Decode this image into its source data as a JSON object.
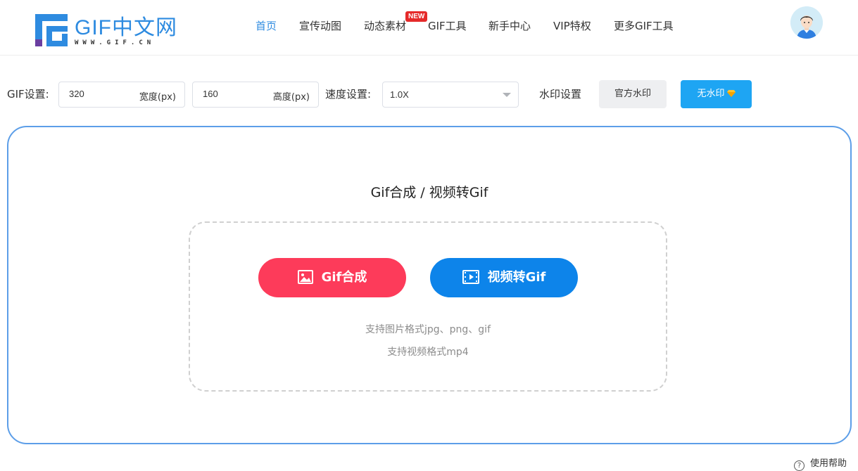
{
  "header": {
    "logo_text": "GIF中文网",
    "logo_sub": "WWW.GIF.CN",
    "nav": [
      {
        "label": "首页"
      },
      {
        "label": "宣传动图"
      },
      {
        "label": "动态素材"
      },
      {
        "label": "GIF工具"
      },
      {
        "label": "新手中心"
      },
      {
        "label": "VIP特权"
      },
      {
        "label": "更多GIF工具"
      }
    ],
    "new_badge": "NEW",
    "active_color": "#2e8be0"
  },
  "settings": {
    "gif_label": "GIF设置:",
    "width_value": "320",
    "width_unit": "宽度(px)",
    "height_value": "160",
    "height_unit": "高度(px)",
    "speed_label": "速度设置:",
    "speed_value": "1.0X",
    "watermark_label": "水印设置",
    "official_watermark": "官方水印",
    "no_watermark": "无水印"
  },
  "main": {
    "title": "Gif合成 / 视频转Gif",
    "gif_compose_button": "Gif合成",
    "video_to_gif_button": "视频转Gif",
    "hint_images": "支持图片格式jpg、png、gif",
    "hint_video": "支持视频格式mp4"
  },
  "footer": {
    "help_label": "使用帮助"
  },
  "colors": {
    "brand_blue": "#2e8be0",
    "red_button": "#fd3b5a",
    "blue_button": "#0d84ea",
    "no_watermark_button": "#1ea5f3"
  }
}
